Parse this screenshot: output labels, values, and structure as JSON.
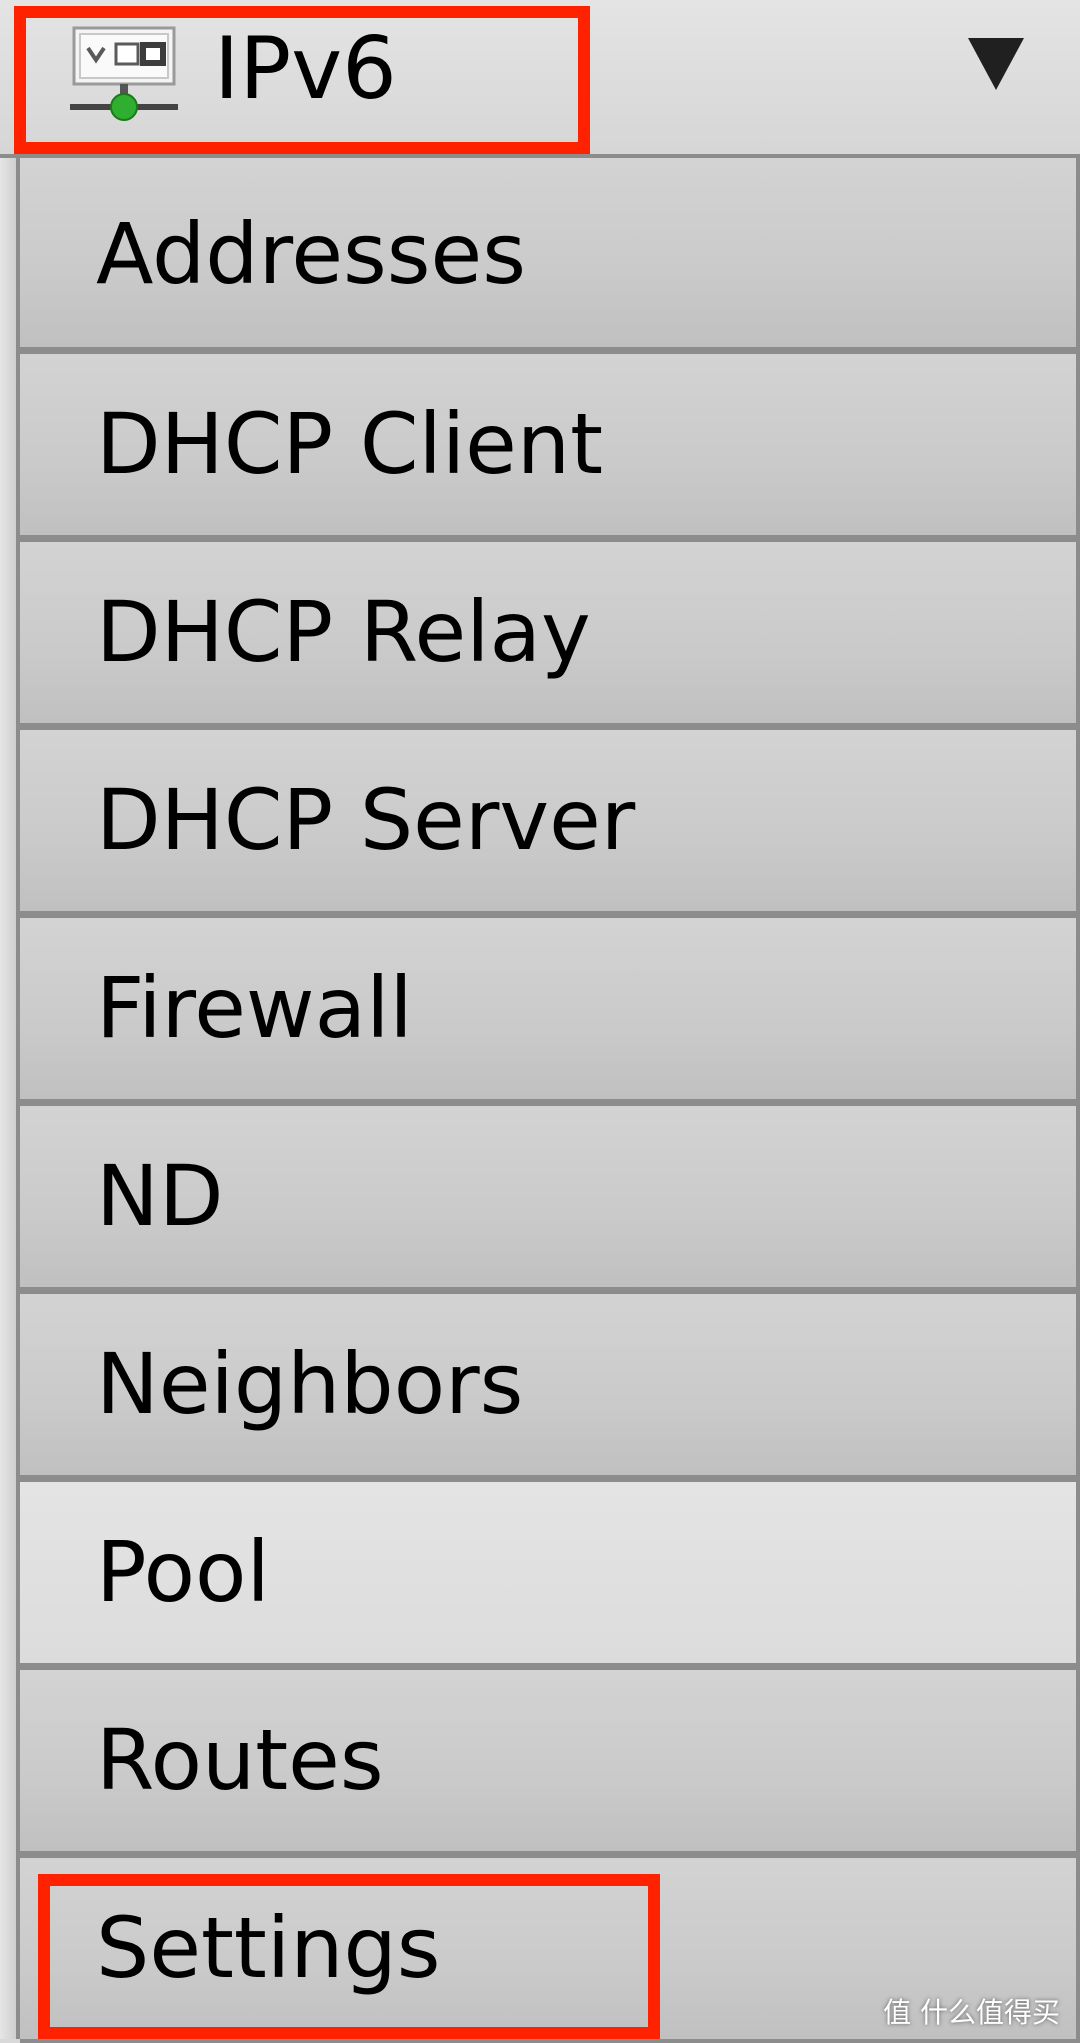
{
  "header": {
    "title": "IPv6",
    "icon": "ipv6-network-icon",
    "dropdown_icon": "dropdown-triangle-icon"
  },
  "menu": {
    "items": [
      {
        "label": "Addresses"
      },
      {
        "label": "DHCP Client"
      },
      {
        "label": "DHCP Relay"
      },
      {
        "label": "DHCP Server"
      },
      {
        "label": "Firewall"
      },
      {
        "label": "ND"
      },
      {
        "label": "Neighbors"
      },
      {
        "label": "Pool",
        "state": "hover"
      },
      {
        "label": "Routes"
      },
      {
        "label": "Settings",
        "highlighted": true
      }
    ]
  },
  "annotations": {
    "highlight_color": "#ff2200"
  },
  "watermark": {
    "text": "值 什么值得买"
  }
}
